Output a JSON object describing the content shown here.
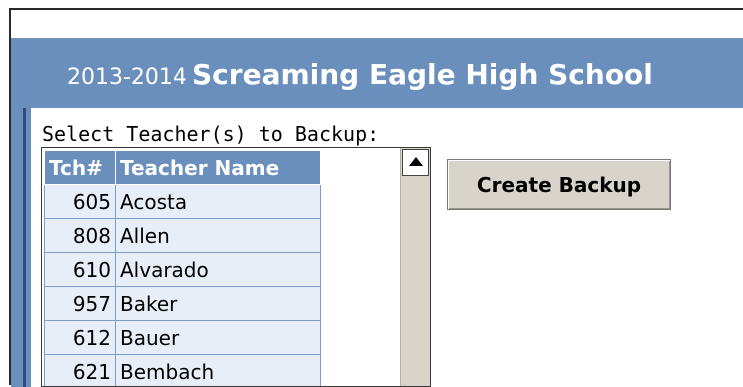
{
  "header": {
    "year": "2013-2014",
    "school": "Screaming Eagle High School"
  },
  "select_label": "Select Teacher(s) to Backup:",
  "table": {
    "columns": [
      "Tch#",
      "Teacher Name"
    ],
    "rows": [
      {
        "num": "605",
        "name": "Acosta"
      },
      {
        "num": "808",
        "name": "Allen"
      },
      {
        "num": "610",
        "name": "Alvarado"
      },
      {
        "num": "957",
        "name": "Baker"
      },
      {
        "num": "612",
        "name": "Bauer"
      },
      {
        "num": "621",
        "name": "Bembach"
      }
    ]
  },
  "create_button": "Create Backup",
  "colors": {
    "header_blue": "#6a8fbd",
    "row_fill": "#e8eef8",
    "button_gray": "#d8d4cc"
  }
}
